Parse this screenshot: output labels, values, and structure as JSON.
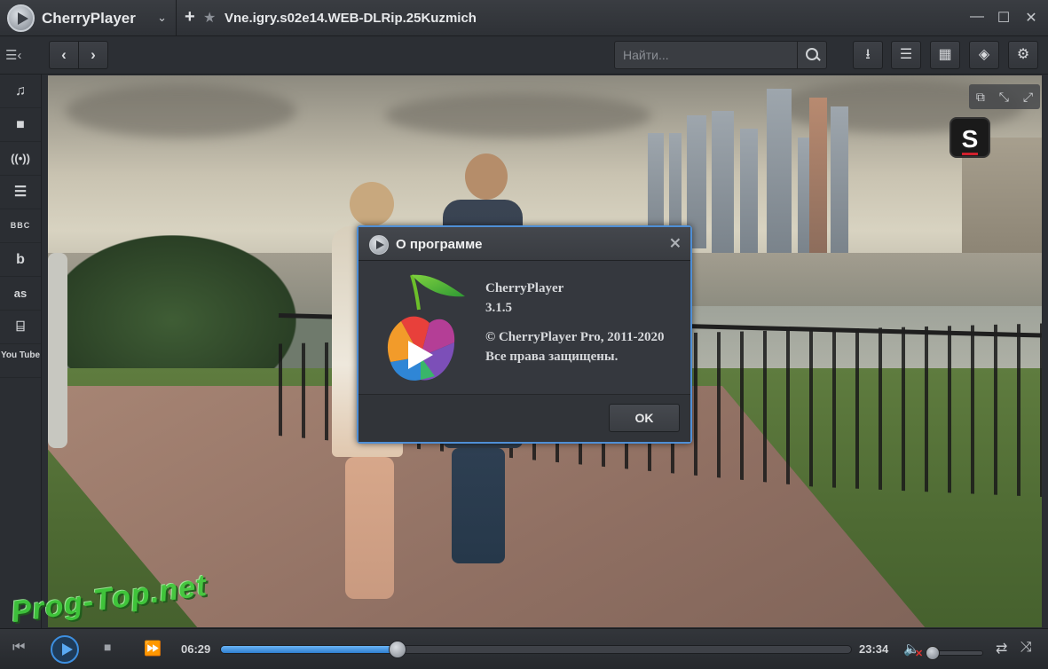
{
  "app": {
    "name": "CherryPlayer",
    "tab_title": "Vne.igry.s02e14.WEB-DLRip.25Kuzmich"
  },
  "window_controls": {
    "minimize": "—",
    "maximize": "☐",
    "close": "✕"
  },
  "toolbar": {
    "back": "‹",
    "forward": "›",
    "search_placeholder": "Найти..."
  },
  "sidebar": {
    "items": [
      {
        "name": "music",
        "glyph": "♫"
      },
      {
        "name": "video",
        "glyph": "■"
      },
      {
        "name": "radio",
        "glyph": "((•))"
      },
      {
        "name": "tv",
        "glyph": "☰"
      },
      {
        "name": "bbc",
        "glyph": "BBC"
      },
      {
        "name": "bandcamp",
        "glyph": "b"
      },
      {
        "name": "lastfm",
        "glyph": "as"
      },
      {
        "name": "twitch",
        "glyph": "⌸"
      },
      {
        "name": "youtube",
        "glyph": "You Tube"
      }
    ]
  },
  "video": {
    "channel_logo": "S"
  },
  "dialog": {
    "title": "О программе",
    "product": "CherryPlayer",
    "version": "3.1.5",
    "copyright": "© CherryPlayer Pro, 2011-2020",
    "rights": "Все права защищены.",
    "ok_label": "OK"
  },
  "playback": {
    "current_time": "06:29",
    "total_time": "23:34",
    "progress": 0.28,
    "volume": 0.0,
    "muted": true
  },
  "overlay_watermark": "Prog-Top.net",
  "colors": {
    "accent": "#4f8fd6",
    "progress": "#3d8fe0",
    "mute": "#e0322f"
  }
}
